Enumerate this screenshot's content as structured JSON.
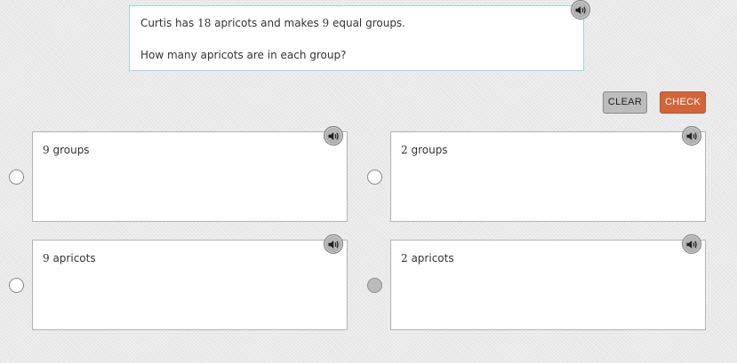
{
  "question": {
    "line1": {
      "pre": "Curtis has ",
      "num1": "18",
      "mid": " apricots and makes ",
      "num2": "9",
      "post": " equal groups."
    },
    "line2": "How many apricots are in each group?",
    "audio_icon": "speaker-icon"
  },
  "buttons": {
    "clear_label": "CLEAR",
    "check_label": "CHECK",
    "check_color": "#d2663a",
    "clear_color": "#bdbdbd"
  },
  "options": [
    {
      "num": "9",
      "unit": " groups",
      "selected": false
    },
    {
      "num": "2",
      "unit": " groups",
      "selected": false
    },
    {
      "num": "9",
      "unit": " apricots",
      "selected": false
    },
    {
      "num": "2",
      "unit": " apricots",
      "selected": false,
      "disabled": true
    }
  ]
}
